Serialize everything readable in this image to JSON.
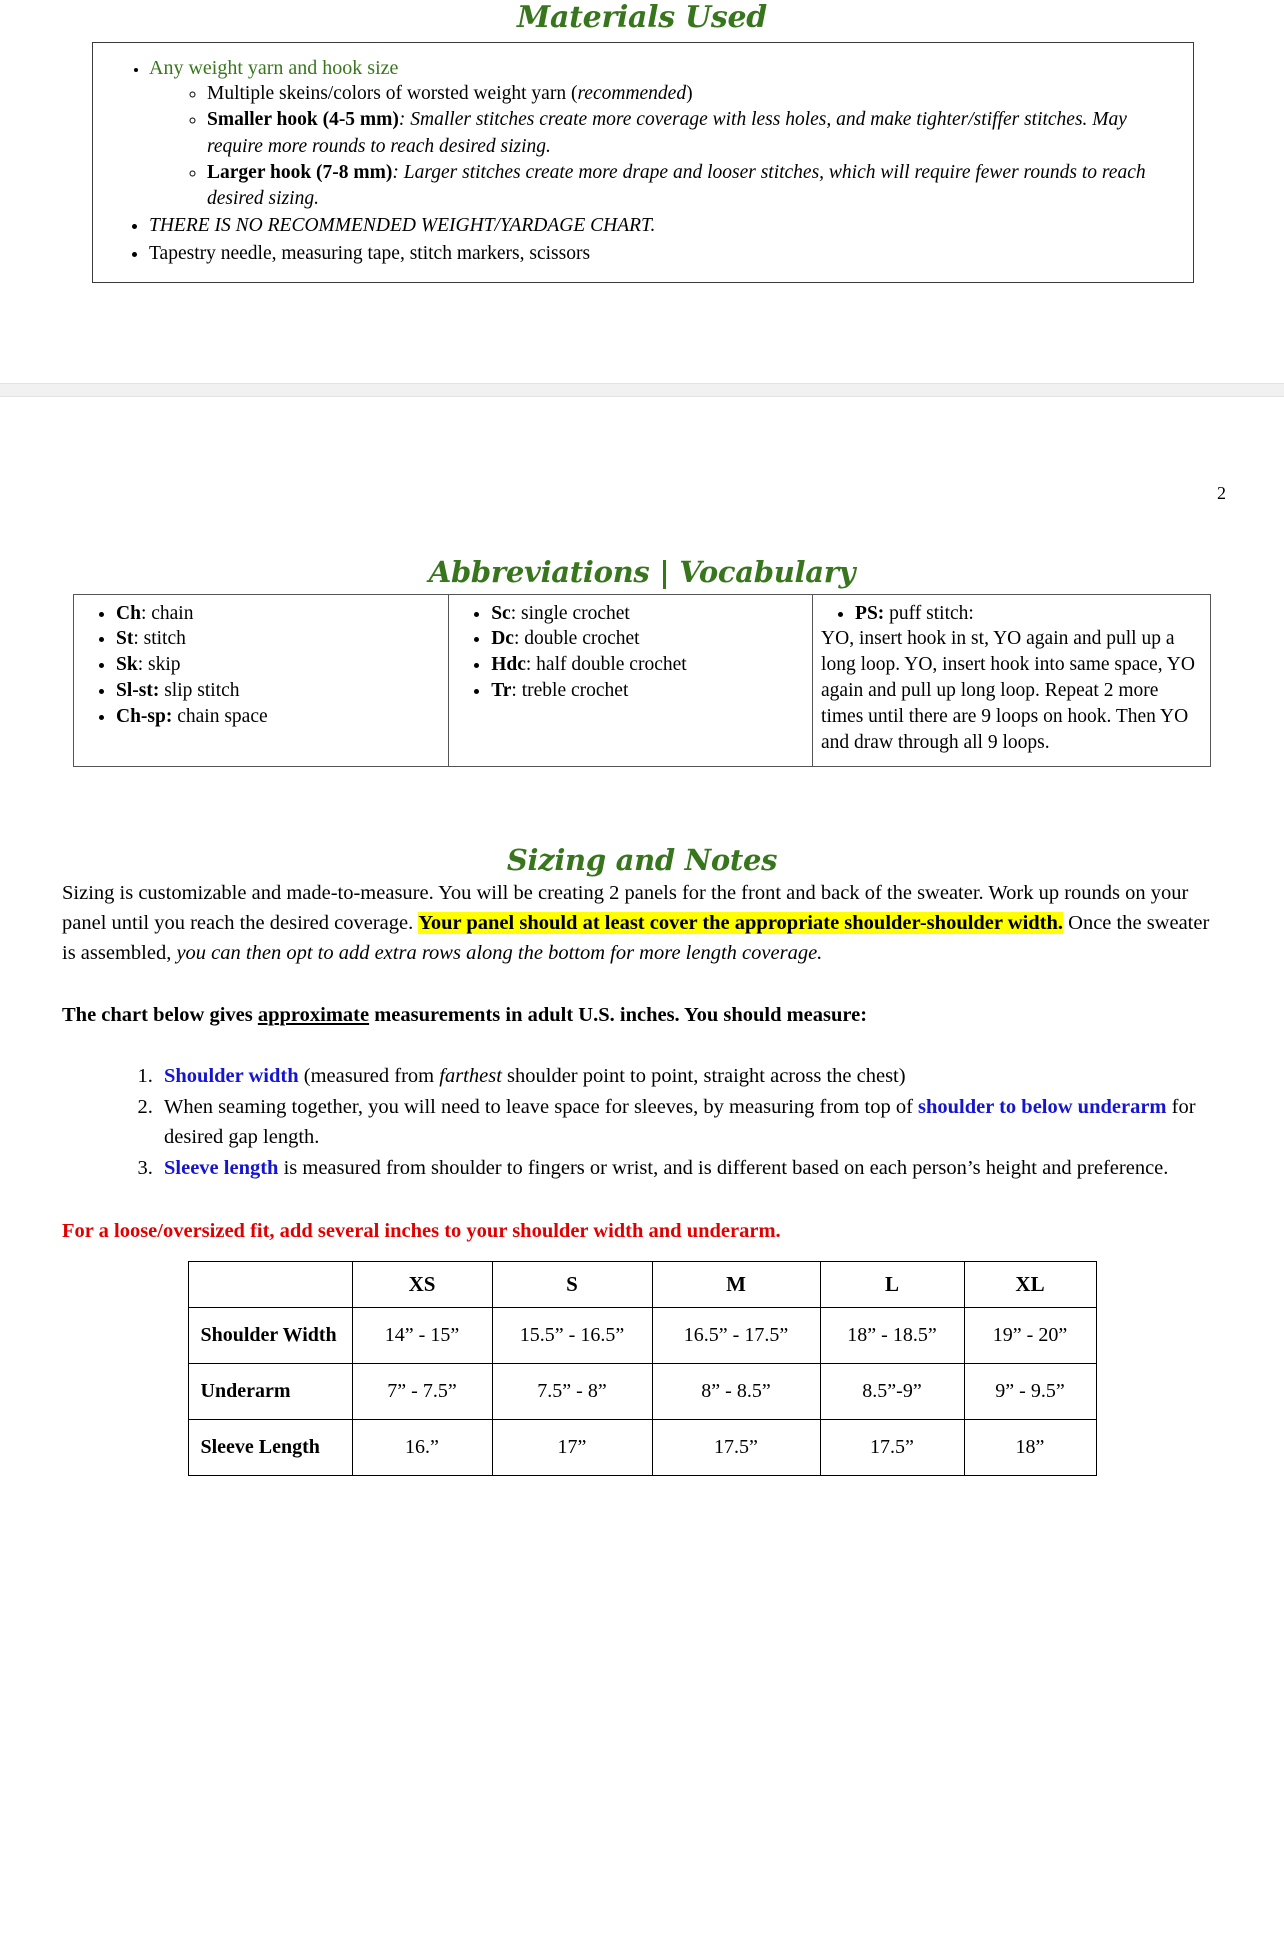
{
  "page1": {
    "title": "Materials Used",
    "materials": {
      "item1": "Any weight yarn and hook size",
      "sub1": "Multiple skeins/colors of worsted weight yarn (",
      "sub1_em": "recommended",
      "sub1_end": ")",
      "sub2_bold": "Smaller hook (4-5 mm)",
      "sub2_rest": ": Smaller stitches create more coverage with less holes, and make tighter/stiffer stitches. May require more rounds to reach desired sizing.",
      "sub3_bold": "Larger hook (7-8 mm)",
      "sub3_rest": ": Larger stitches create more drape and looser stitches, which will require fewer rounds to reach desired sizing.",
      "item2": "THERE IS NO RECOMMENDED WEIGHT/YARDAGE CHART.",
      "item3": "Tapestry needle, measuring tape,  stitch markers, scissors"
    }
  },
  "page2": {
    "page_number": "2",
    "abbrev_title": "Abbreviations | Vocabulary",
    "abbrev": {
      "col1": [
        {
          "term": "Ch",
          "def": ": chain"
        },
        {
          "term": "St",
          "def": ": stitch"
        },
        {
          "term": "Sk",
          "def": ": skip"
        },
        {
          "term": "Sl-st:",
          "def": " slip stitch"
        },
        {
          "term": "Ch-sp:",
          "def": " chain space"
        }
      ],
      "col2": [
        {
          "term": "Sc",
          "def": ": single crochet"
        },
        {
          "term": "Dc",
          "def": ": double crochet"
        },
        {
          "term": "Hdc",
          "def": ": half double crochet"
        },
        {
          "term": "Tr",
          "def": ": treble crochet"
        }
      ],
      "col3": {
        "term": "PS:",
        "def": " puff stitch:",
        "body": "YO, insert hook in st, YO again and pull up a long loop. YO, insert hook into same space, YO again and pull up long loop. Repeat 2 more times until there are 9 loops on hook. Then YO and draw through all 9 loops."
      }
    },
    "sizing_title": "Sizing and Notes",
    "sizing_para": {
      "p1": "Sizing is customizable and made-to-measure. You will be creating 2 panels for the front and back of the sweater. Work up rounds on your panel until you reach the desired coverage. ",
      "p2_hl": "Your panel should at least cover the appropriate shoulder-shoulder width.",
      "p3": " Once the sweater is assembled, ",
      "p4_em": "you can then opt to add extra rows along the bottom for more length coverage."
    },
    "chart_intro": {
      "a": "The chart below gives ",
      "b_u": "approximate",
      "c": " measurements in adult U.S. inches. You should measure:"
    },
    "steps": {
      "s1_blue": "Shoulder width",
      "s1_rest_a": " (measured from ",
      "s1_em": "farthest",
      "s1_rest_b": " shoulder point to point, straight across the chest)",
      "s2_a": "When seaming together, you will need to leave space for sleeves, by measuring from top of ",
      "s2_blue": "shoulder to below underarm",
      "s2_b": " for desired gap length.",
      "s3_blue": "Sleeve length",
      "s3_rest": " is measured from shoulder to fingers or wrist, and is different based on each person’s height and preference."
    },
    "warning": "For a loose/oversized fit, add several inches to your shoulder width and underarm.",
    "colors": {
      "heading_green": "#38761d",
      "highlight_yellow": "#ffff00",
      "accent_blue": "#1515cf",
      "warning_red": "#e00000"
    }
  },
  "chart_data": {
    "type": "table",
    "title": "Approximate measurements in adult U.S. inches",
    "categories": [
      "XS",
      "S",
      "M",
      "L",
      "XL"
    ],
    "row_label_header": "",
    "rows": [
      {
        "label": "Shoulder Width",
        "values": [
          "14” - 15”",
          "15.5” - 16.5”",
          "16.5” - 17.5”",
          "18” - 18.5”",
          "19” - 20”"
        ]
      },
      {
        "label": "Underarm",
        "values": [
          "7” - 7.5”",
          "7.5” - 8”",
          "8” - 8.5”",
          "8.5”-9”",
          "9” - 9.5”"
        ]
      },
      {
        "label": "Sleeve Length",
        "values": [
          "16.”",
          "17”",
          "17.5”",
          "17.5”",
          "18”"
        ]
      }
    ]
  }
}
